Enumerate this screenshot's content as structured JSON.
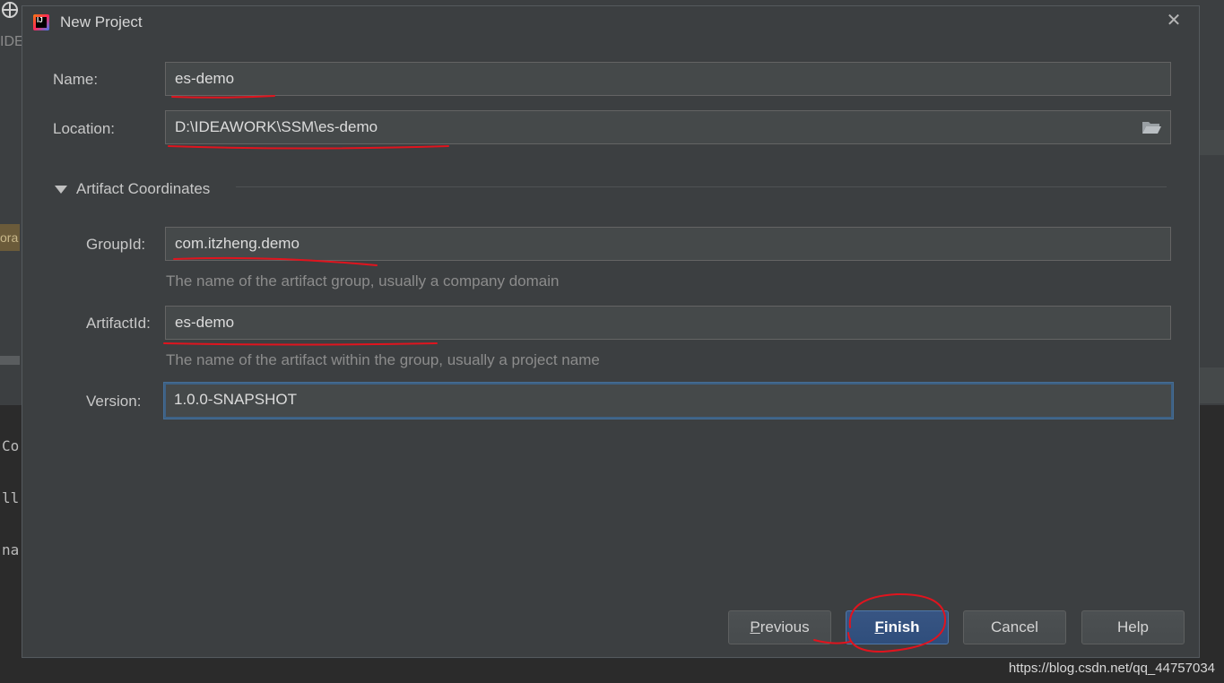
{
  "background": {
    "left_fragment_top": "IDE",
    "left_fragment_badge": "ora",
    "code_fragments": [
      "Co",
      "ll",
      "na"
    ]
  },
  "dialog": {
    "title": "New Project",
    "close_glyph": "✕",
    "name_label": "Name:",
    "name_value": "es-demo",
    "location_label": "Location:",
    "location_value": "D:\\IDEAWORK\\SSM\\es-demo",
    "section_title": "Artifact Coordinates",
    "groupid_label": "GroupId:",
    "groupid_value": "com.itzheng.demo",
    "groupid_hint": "The name of the artifact group, usually a company domain",
    "artifactid_label": "ArtifactId:",
    "artifactid_value": "es-demo",
    "artifactid_hint": "The name of the artifact within the group, usually a project name",
    "version_label": "Version:",
    "version_value": "1.0.0-SNAPSHOT",
    "buttons": {
      "previous_first": "P",
      "previous_rest": "revious",
      "finish_first": "F",
      "finish_rest": "inish",
      "cancel": "Cancel",
      "help": "Help"
    }
  },
  "watermark": "https://blog.csdn.net/qq_44757034",
  "colors": {
    "dialog_bg": "#3c3f41",
    "field_bg": "#45494a",
    "accent_focus": "#3d6185",
    "primary_button": "#365880",
    "annotation_red": "#e0141e"
  }
}
